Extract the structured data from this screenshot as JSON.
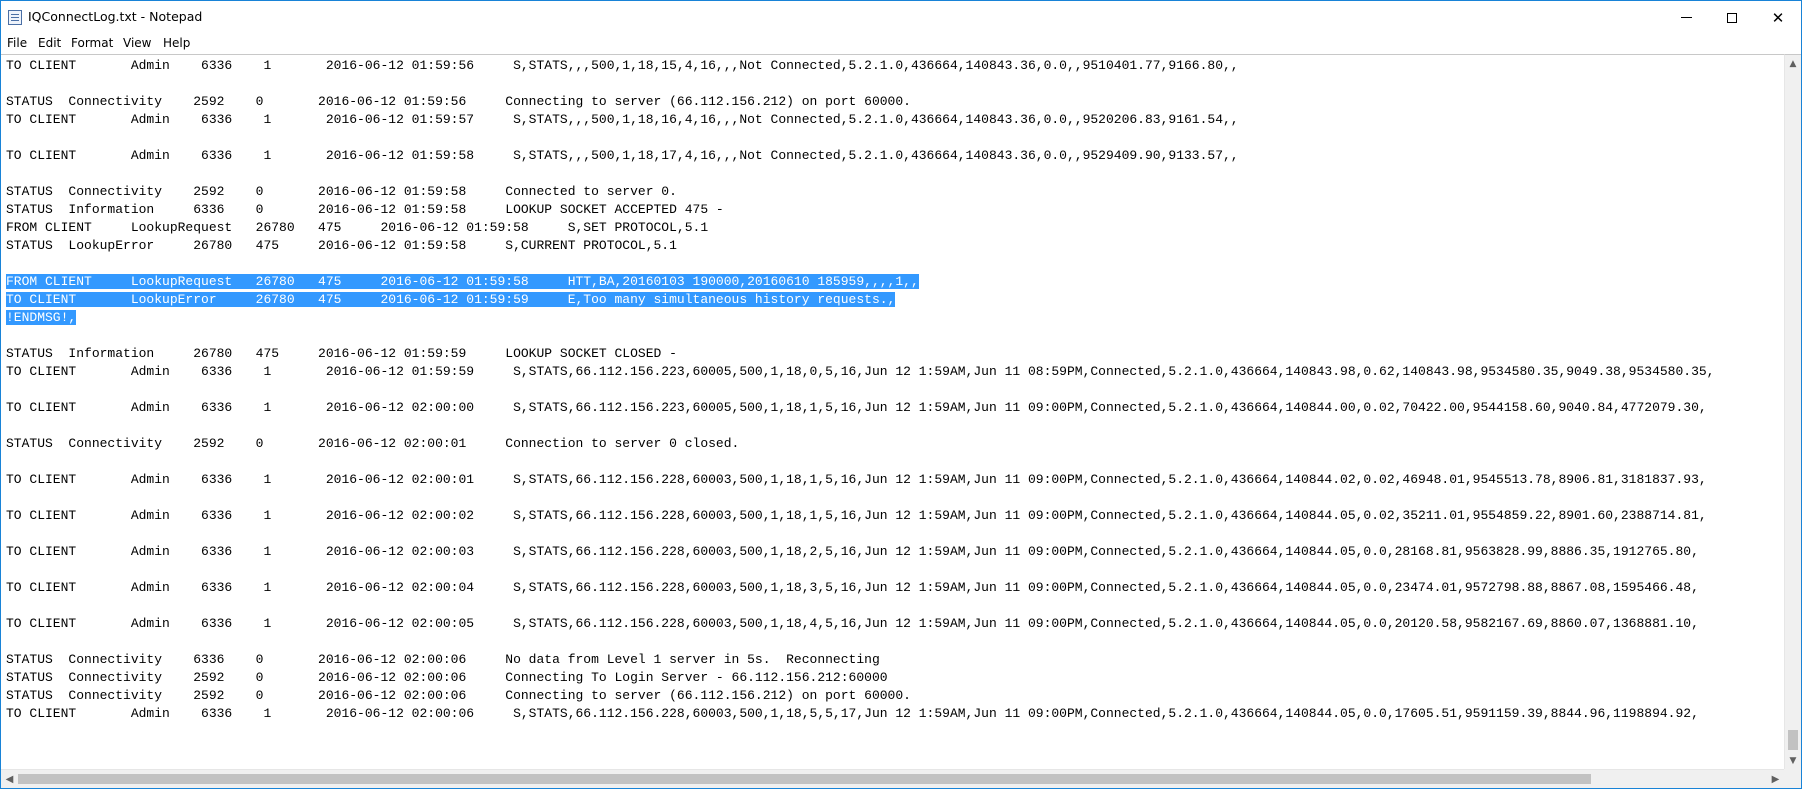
{
  "window": {
    "title": "IQConnectLog.txt - Notepad",
    "icon": "notepad-icon"
  },
  "controls": {
    "minimize": "minimize-icon",
    "maximize": "maximize-icon",
    "close_glyph": "✕"
  },
  "menu": {
    "items": [
      "File",
      "Edit",
      "Format",
      "View",
      "Help"
    ]
  },
  "colors": {
    "selection": "#3399ff",
    "window_border": "#1883d7"
  },
  "lines": [
    {
      "text": "TO CLIENT       Admin    6336    1       2016-06-12 01:59:56     S,STATS,,,500,1,18,15,4,16,,,Not Connected,5.2.1.0,436664,140843.36,0.0,,9510401.77,9166.80,,",
      "selected": false
    },
    {
      "text": "",
      "selected": false
    },
    {
      "text": "STATUS  Connectivity    2592    0       2016-06-12 01:59:56     Connecting to server (66.112.156.212) on port 60000.",
      "selected": false
    },
    {
      "text": "TO CLIENT       Admin    6336    1       2016-06-12 01:59:57     S,STATS,,,500,1,18,16,4,16,,,Not Connected,5.2.1.0,436664,140843.36,0.0,,9520206.83,9161.54,,",
      "selected": false
    },
    {
      "text": "",
      "selected": false
    },
    {
      "text": "TO CLIENT       Admin    6336    1       2016-06-12 01:59:58     S,STATS,,,500,1,18,17,4,16,,,Not Connected,5.2.1.0,436664,140843.36,0.0,,9529409.90,9133.57,,",
      "selected": false
    },
    {
      "text": "",
      "selected": false
    },
    {
      "text": "STATUS  Connectivity    2592    0       2016-06-12 01:59:58     Connected to server 0.",
      "selected": false
    },
    {
      "text": "STATUS  Information     6336    0       2016-06-12 01:59:58     LOOKUP SOCKET ACCEPTED 475 -",
      "selected": false
    },
    {
      "text": "FROM CLIENT     LookupRequest   26780   475     2016-06-12 01:59:58     S,SET PROTOCOL,5.1",
      "selected": false
    },
    {
      "text": "STATUS  LookupError     26780   475     2016-06-12 01:59:58     S,CURRENT PROTOCOL,5.1",
      "selected": false
    },
    {
      "text": "",
      "selected": false
    },
    {
      "text": "FROM CLIENT     LookupRequest   26780   475     2016-06-12 01:59:58     HTT,BA,20160103 190000,20160610 185959,,,,1,,",
      "selected": true
    },
    {
      "text": "TO CLIENT       LookupError     26780   475     2016-06-12 01:59:59     E,Too many simultaneous history requests.,",
      "selected": true
    },
    {
      "text": "!ENDMSG!,",
      "selected": true
    },
    {
      "text": "",
      "selected": false
    },
    {
      "text": "STATUS  Information     26780   475     2016-06-12 01:59:59     LOOKUP SOCKET CLOSED -",
      "selected": false
    },
    {
      "text": "TO CLIENT       Admin    6336    1       2016-06-12 01:59:59     S,STATS,66.112.156.223,60005,500,1,18,0,5,16,Jun 12 1:59AM,Jun 11 08:59PM,Connected,5.2.1.0,436664,140843.98,0.62,140843.98,9534580.35,9049.38,9534580.35,",
      "selected": false
    },
    {
      "text": "",
      "selected": false
    },
    {
      "text": "TO CLIENT       Admin    6336    1       2016-06-12 02:00:00     S,STATS,66.112.156.223,60005,500,1,18,1,5,16,Jun 12 1:59AM,Jun 11 09:00PM,Connected,5.2.1.0,436664,140844.00,0.02,70422.00,9544158.60,9040.84,4772079.30,",
      "selected": false
    },
    {
      "text": "",
      "selected": false
    },
    {
      "text": "STATUS  Connectivity    2592    0       2016-06-12 02:00:01     Connection to server 0 closed.",
      "selected": false
    },
    {
      "text": "",
      "selected": false
    },
    {
      "text": "TO CLIENT       Admin    6336    1       2016-06-12 02:00:01     S,STATS,66.112.156.228,60003,500,1,18,1,5,16,Jun 12 1:59AM,Jun 11 09:00PM,Connected,5.2.1.0,436664,140844.02,0.02,46948.01,9545513.78,8906.81,3181837.93,",
      "selected": false
    },
    {
      "text": "",
      "selected": false
    },
    {
      "text": "TO CLIENT       Admin    6336    1       2016-06-12 02:00:02     S,STATS,66.112.156.228,60003,500,1,18,1,5,16,Jun 12 1:59AM,Jun 11 09:00PM,Connected,5.2.1.0,436664,140844.05,0.02,35211.01,9554859.22,8901.60,2388714.81,",
      "selected": false
    },
    {
      "text": "",
      "selected": false
    },
    {
      "text": "TO CLIENT       Admin    6336    1       2016-06-12 02:00:03     S,STATS,66.112.156.228,60003,500,1,18,2,5,16,Jun 12 1:59AM,Jun 11 09:00PM,Connected,5.2.1.0,436664,140844.05,0.0,28168.81,9563828.99,8886.35,1912765.80,",
      "selected": false
    },
    {
      "text": "",
      "selected": false
    },
    {
      "text": "TO CLIENT       Admin    6336    1       2016-06-12 02:00:04     S,STATS,66.112.156.228,60003,500,1,18,3,5,16,Jun 12 1:59AM,Jun 11 09:00PM,Connected,5.2.1.0,436664,140844.05,0.0,23474.01,9572798.88,8867.08,1595466.48,",
      "selected": false
    },
    {
      "text": "",
      "selected": false
    },
    {
      "text": "TO CLIENT       Admin    6336    1       2016-06-12 02:00:05     S,STATS,66.112.156.228,60003,500,1,18,4,5,16,Jun 12 1:59AM,Jun 11 09:00PM,Connected,5.2.1.0,436664,140844.05,0.0,20120.58,9582167.69,8860.07,1368881.10,",
      "selected": false
    },
    {
      "text": "",
      "selected": false
    },
    {
      "text": "STATUS  Connectivity    6336    0       2016-06-12 02:00:06     No data from Level 1 server in 5s.  Reconnecting",
      "selected": false
    },
    {
      "text": "STATUS  Connectivity    2592    0       2016-06-12 02:00:06     Connecting To Login Server - 66.112.156.212:60000",
      "selected": false
    },
    {
      "text": "STATUS  Connectivity    2592    0       2016-06-12 02:00:06     Connecting to server (66.112.156.212) on port 60000.",
      "selected": false
    },
    {
      "text": "TO CLIENT       Admin    6336    1       2016-06-12 02:00:06     S,STATS,66.112.156.228,60003,500,1,18,5,5,17,Jun 12 1:59AM,Jun 11 09:00PM,Connected,5.2.1.0,436664,140844.05,0.0,17605.51,9591159.39,8844.96,1198894.92,",
      "selected": false
    }
  ]
}
